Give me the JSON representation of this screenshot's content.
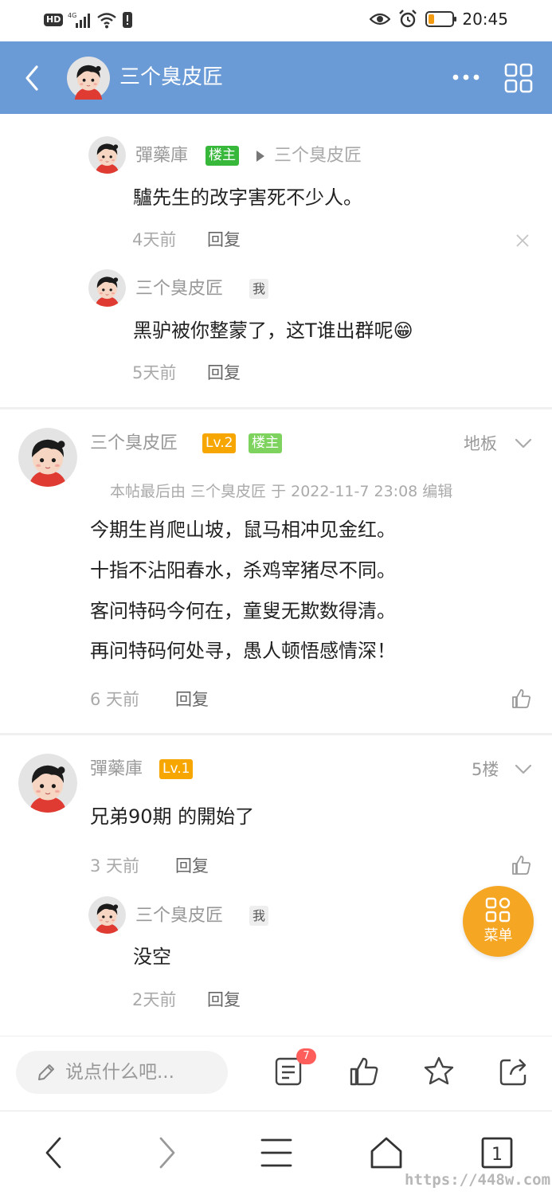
{
  "status_bar": {
    "left_icons": [
      "hd-icon",
      "signal-4g-icon",
      "wifi-icon",
      "alert-icon"
    ],
    "hd_label": "HD",
    "right_icons": [
      "eye-icon",
      "alarm-icon",
      "battery-icon"
    ],
    "battery_level": 0.2,
    "time": "20:45"
  },
  "header": {
    "title": "三个臭皮匠",
    "back_icon": "chevron-left-icon",
    "more_icon": "more-dots-icon",
    "grid_icon": "grid-icon"
  },
  "comments": {
    "sub1": {
      "author": "彈藥庫",
      "badge": "楼主",
      "reply_to": "三个臭皮匠",
      "text": "驢先生的改字害死不少人。",
      "time": "4天前",
      "reply_label": "回复"
    },
    "sub2": {
      "author": "三个臭皮匠",
      "badge": "我",
      "text": "黑驴被你整蒙了，这T谁出群呢",
      "emoji": "😁",
      "time": "5天前",
      "reply_label": "回复"
    },
    "main_floor": {
      "author": "三个臭皮匠",
      "level": "Lv.2",
      "badge": "楼主",
      "floor": "地板",
      "edit_note": "本帖最后由 三个臭皮匠 于 2022-11-7 23:08 编辑",
      "lines": [
        "今期生肖爬山坡，鼠马相冲见金红。",
        "十指不沾阳春水，杀鸡宰猪尽不同。",
        "客问特码今何在，童叟无欺数得清。",
        "再问特码何处寻，愚人顿悟感情深！"
      ],
      "time": "6 天前",
      "reply_label": "回复"
    },
    "fifth": {
      "author": "彈藥庫",
      "level": "Lv.1",
      "floor": "5楼",
      "text": "兄弟90期 的開始了",
      "time": "3 天前",
      "reply_label": "回复"
    },
    "sub3": {
      "author": "三个臭皮匠",
      "badge": "我",
      "text": "没空",
      "time": "2天前",
      "reply_label": "回复"
    }
  },
  "fab": {
    "label": "菜单",
    "icon": "apps-grid-icon"
  },
  "action_bar": {
    "input_placeholder": "说点什么吧...",
    "comments_count": "7",
    "icons": [
      "comments-icon",
      "thumbs-up-icon",
      "star-icon",
      "share-icon"
    ]
  },
  "nav_bar": {
    "tab_count": "1",
    "icons": [
      "back-icon",
      "forward-icon",
      "menu-icon",
      "home-icon",
      "tabs-icon"
    ]
  },
  "watermark": "https://448w.com",
  "colors": {
    "header_bg": "#6b9bd6",
    "badge_green": "#38b83b",
    "badge_light_green": "#7ed35f",
    "badge_orange": "#f7a600",
    "fab_bg": "#f5a623",
    "count_badge": "#ff5e5b"
  }
}
